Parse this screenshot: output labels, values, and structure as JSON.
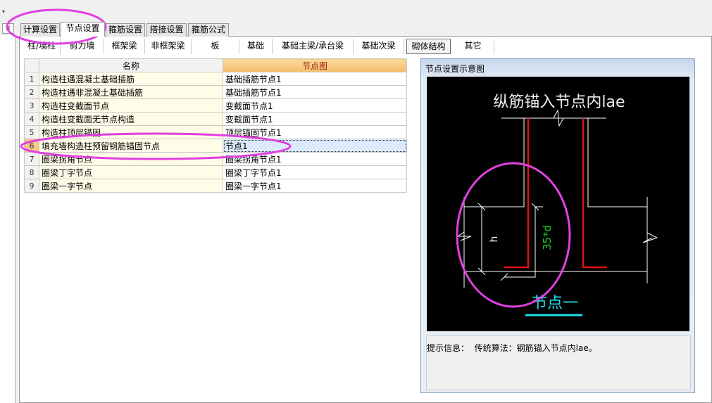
{
  "top": {
    "dropdown_icon": "▾",
    "close_icon": "✕"
  },
  "tabs": [
    {
      "label": "计算设置"
    },
    {
      "label": "节点设置",
      "active": true
    },
    {
      "label": "箍筋设置"
    },
    {
      "label": "搭接设置"
    },
    {
      "label": "箍筋公式"
    }
  ],
  "subtabs": [
    {
      "label": "柱/墙柱"
    },
    {
      "label": "剪力墙"
    },
    {
      "label": "框架梁"
    },
    {
      "label": "非框架梁"
    },
    {
      "label": "板"
    },
    {
      "label": "基础"
    },
    {
      "label": "基础主梁/承台梁"
    },
    {
      "label": "基础次梁"
    },
    {
      "label": "砌体结构",
      "active": true
    },
    {
      "label": "其它"
    }
  ],
  "table": {
    "headers": [
      "名称",
      "节点图"
    ],
    "rows": [
      {
        "num": "1",
        "name": "构造柱遇混凝土基础插筋",
        "value": "基础插筋节点1"
      },
      {
        "num": "2",
        "name": "构造柱遇非混凝土基础插筋",
        "value": "基础插筋节点1"
      },
      {
        "num": "3",
        "name": "构造柱变截面节点",
        "value": "变截面节点1"
      },
      {
        "num": "4",
        "name": "构造柱变截面无节点构造",
        "value": "变截面节点1"
      },
      {
        "num": "5",
        "name": "构造柱顶层锚固",
        "value": "顶层锚固节点1"
      },
      {
        "num": "6",
        "name": "填充墙构造柱预留钢筋锚固节点",
        "value": "节点1"
      },
      {
        "num": "7",
        "name": "圈梁拐角节点",
        "value": "圈梁拐角节点1"
      },
      {
        "num": "8",
        "name": "圈梁丁字节点",
        "value": "圈梁丁字节点1"
      },
      {
        "num": "9",
        "name": "圈梁一字节点",
        "value": "圈梁一字节点1"
      }
    ],
    "selected_row": 6
  },
  "preview": {
    "title": "节点设置示意图",
    "diagram_title": "纵筋锚入节点内lae",
    "dim_h": "h",
    "dim_anchor": "35*d",
    "caption": "节点一",
    "info_label": "提示信息：",
    "info_text": "传统算法：钢筋锚入节点内lae。"
  },
  "colors": {
    "rebar": "#e01010",
    "dim_text": "#22cc22",
    "caption": "#20e0e8",
    "annotation": "#e040e0",
    "header_accent": "#f2bd6c"
  }
}
